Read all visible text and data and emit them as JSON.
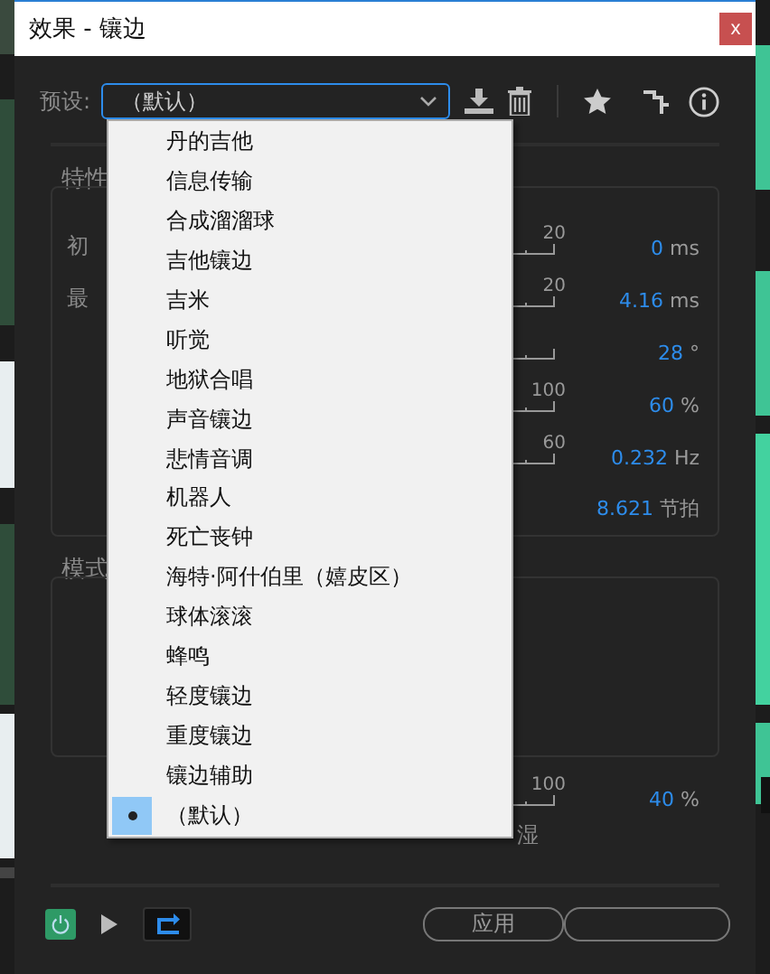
{
  "window": {
    "title": "效果 - 镶边",
    "close": "x"
  },
  "preset": {
    "label": "预设:",
    "value": "（默认）"
  },
  "preset_menu": [
    {
      "label": "丹的吉他",
      "selected": false
    },
    {
      "label": "信息传输",
      "selected": false
    },
    {
      "label": "合成溜溜球",
      "selected": false
    },
    {
      "label": "吉他镶边",
      "selected": false
    },
    {
      "label": "吉米",
      "selected": false
    },
    {
      "label": "听觉",
      "selected": false
    },
    {
      "label": "地狱合唱",
      "selected": false
    },
    {
      "label": "声音镶边",
      "selected": false
    },
    {
      "label": "悲情音调",
      "selected": false
    },
    {
      "label": "机器人",
      "selected": false
    },
    {
      "label": "死亡丧钟",
      "selected": false
    },
    {
      "label": "海特·阿什伯里（嬉皮区）",
      "selected": false
    },
    {
      "label": "球体滚滚",
      "selected": false
    },
    {
      "label": "蜂鸣",
      "selected": false
    },
    {
      "label": "轻度镶边",
      "selected": false
    },
    {
      "label": "重度镶边",
      "selected": false
    },
    {
      "label": "镶边辅助",
      "selected": false
    },
    {
      "label": "（默认）",
      "selected": true
    }
  ],
  "characteristics": {
    "title": "特性",
    "labels": [
      "初",
      "最"
    ],
    "params": [
      {
        "kind": "slider",
        "max": "20",
        "value": "0",
        "unit": "ms"
      },
      {
        "kind": "slider",
        "max": "20",
        "value": "4.16",
        "unit": "ms"
      },
      {
        "kind": "slider",
        "value": "28",
        "unit": "°"
      },
      {
        "kind": "slider",
        "max": "100",
        "value": "60",
        "unit": "%"
      },
      {
        "kind": "slider",
        "max": "60",
        "value": "0.232",
        "unit": "Hz"
      },
      {
        "kind": "value",
        "value": "8.621",
        "unit": "节拍"
      }
    ]
  },
  "mode": {
    "title": "模式"
  },
  "mix": {
    "max": "100",
    "value": "40",
    "unit": "%",
    "label": "湿"
  },
  "footer": {
    "power_on": true,
    "apply": "应用"
  }
}
